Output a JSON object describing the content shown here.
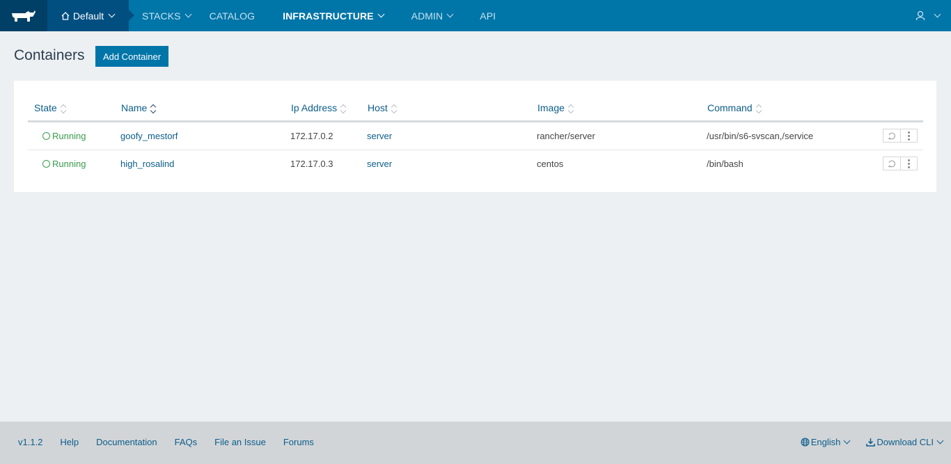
{
  "nav": {
    "environment": "Default",
    "items": [
      {
        "label": "STACKS",
        "dropdown": true,
        "active": false
      },
      {
        "label": "CATALOG",
        "dropdown": false,
        "active": false
      },
      {
        "label": "INFRASTRUCTURE",
        "dropdown": true,
        "active": true
      },
      {
        "label": "ADMIN",
        "dropdown": true,
        "active": false
      },
      {
        "label": "API",
        "dropdown": false,
        "active": false
      }
    ]
  },
  "page": {
    "title": "Containers",
    "add_button": "Add Container"
  },
  "table": {
    "columns": [
      "State",
      "Name",
      "Ip Address",
      "Host",
      "Image",
      "Command"
    ],
    "sorted_column": "Name",
    "rows": [
      {
        "state": "Running",
        "name": "goofy_mestorf",
        "ip": "172.17.0.2",
        "host": "server",
        "image": "rancher/server",
        "command": "/usr/bin/s6-svscan,/service"
      },
      {
        "state": "Running",
        "name": "high_rosalind",
        "ip": "172.17.0.3",
        "host": "server",
        "image": "centos",
        "command": "/bin/bash"
      }
    ]
  },
  "footer": {
    "version": "v1.1.2",
    "links": [
      "Help",
      "Documentation",
      "FAQs",
      "File an Issue",
      "Forums"
    ],
    "language": "English",
    "download": "Download CLI"
  },
  "colors": {
    "nav_bg": "#0075a8",
    "accent": "#0075a8",
    "running": "#3a9b4e",
    "link": "#0b5d8a"
  }
}
